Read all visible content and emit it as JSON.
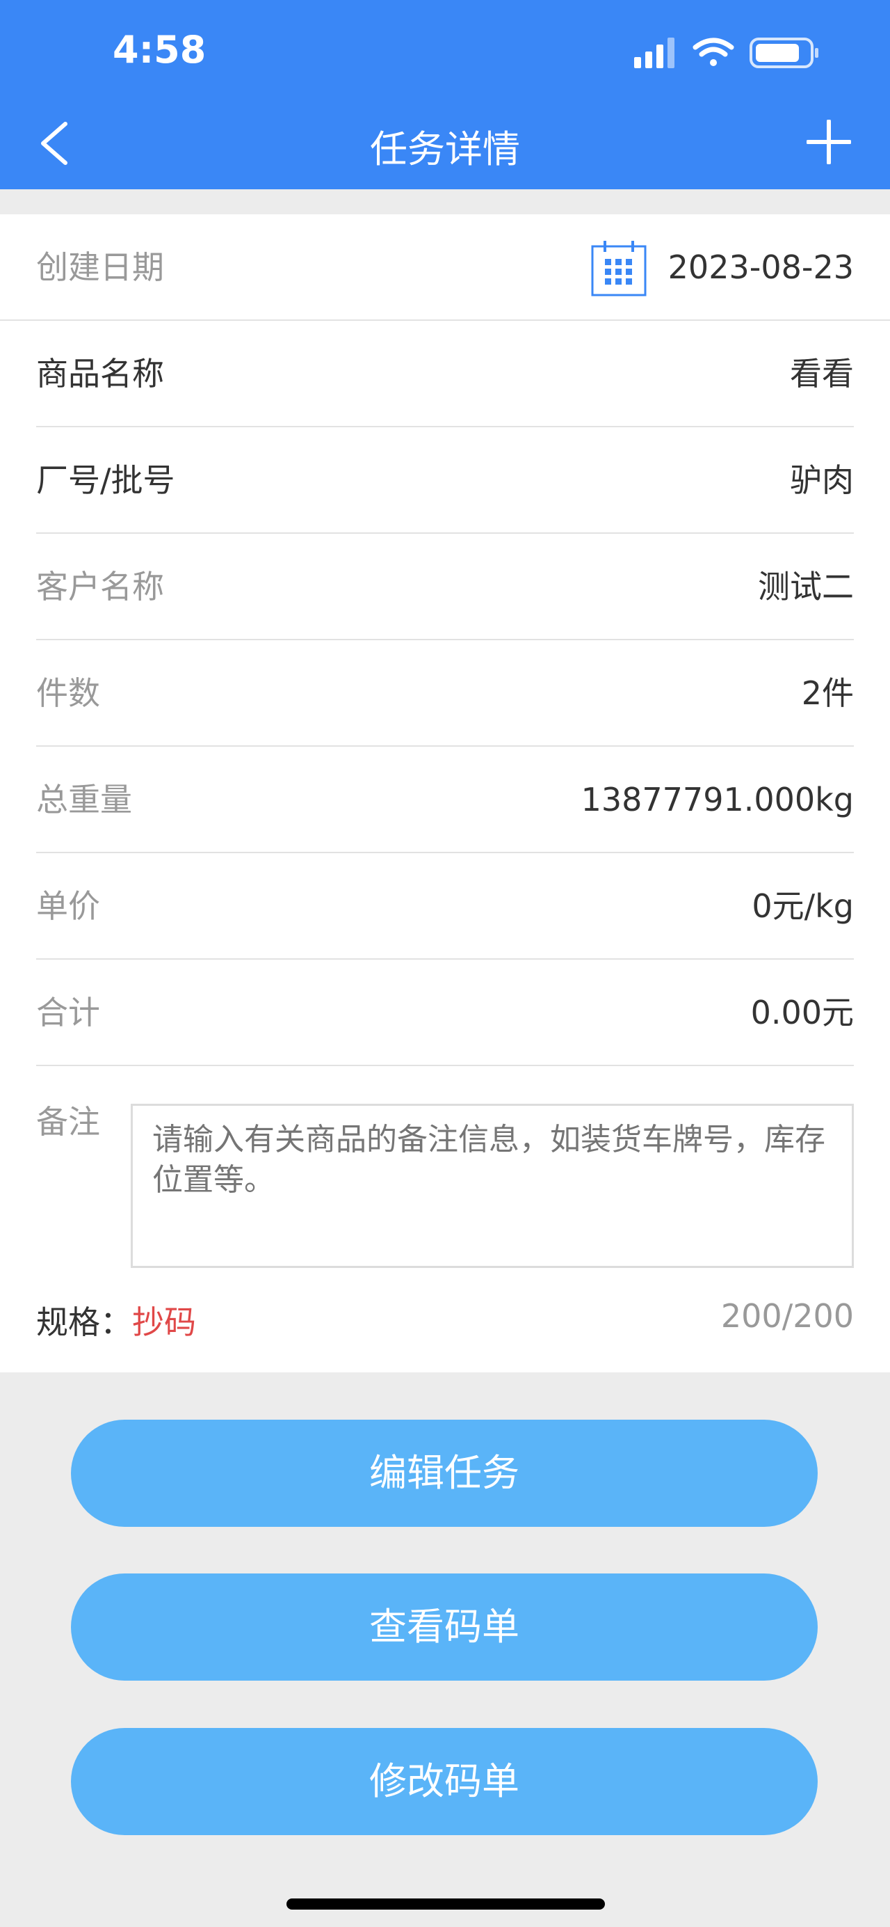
{
  "status_bar": {
    "time": "4:58"
  },
  "nav": {
    "title": "任务详情"
  },
  "fields": {
    "create_date": {
      "label": "创建日期",
      "value": "2023-08-23"
    },
    "product_name": {
      "label": "商品名称",
      "value": "看看"
    },
    "factory_batch": {
      "label": "厂号/批号",
      "value": "驴肉"
    },
    "customer_name": {
      "label": "客户名称",
      "value": "测试二"
    },
    "pieces": {
      "label": "件数",
      "value": "2件"
    },
    "total_weight": {
      "label": "总重量",
      "value": "13877791.000kg"
    },
    "unit_price": {
      "label": "单价",
      "value": "0元/kg"
    },
    "total": {
      "label": "合计",
      "value": "0.00元"
    }
  },
  "remark": {
    "label": "备注",
    "placeholder": "请输入有关商品的备注信息，如装货车牌号，库存位置等。",
    "counter": "200/200"
  },
  "spec": {
    "label": "规格：",
    "value": "抄码"
  },
  "buttons": {
    "edit_task": "编辑任务",
    "view_code_list": "查看码单",
    "modify_code_list": "修改码单"
  },
  "colors": {
    "header": "#3a87f6",
    "button": "#5ab4f8",
    "spec_value": "#e04848"
  }
}
